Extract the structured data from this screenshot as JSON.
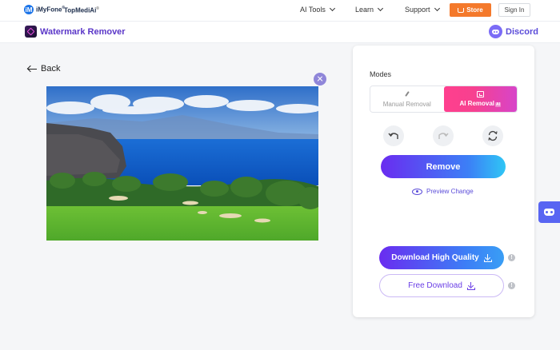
{
  "header": {
    "brand_mark": "iM",
    "brand": "iMyFone",
    "brand_sup": "®",
    "product_brand": "TopMediAi",
    "product_sup": "®",
    "nav": [
      {
        "label": "AI Tools"
      },
      {
        "label": "Learn"
      },
      {
        "label": "Support"
      }
    ],
    "store_label": "Store",
    "signin_label": "Sign In"
  },
  "toolbar": {
    "app_title": "Watermark Remover",
    "discord_label": "Discord"
  },
  "main": {
    "back_label": "Back"
  },
  "panel": {
    "modes_label": "Modes",
    "modes": [
      {
        "label": "Manual Removal",
        "active": false
      },
      {
        "label": "AI Removal",
        "badge": "AI",
        "active": true
      }
    ],
    "tools": [
      "undo-icon",
      "redo-icon",
      "reset-icon"
    ],
    "remove_label": "Remove",
    "preview_label": "Preview Change",
    "download_hq_label": "Download High Quality",
    "download_free_label": "Free Download",
    "info_symbol": "!"
  },
  "colors": {
    "accent_purple": "#6a2cf0",
    "accent_blue": "#3c7ff6",
    "ai_mode_pink": "#ff3f8e",
    "store_orange": "#f4792b",
    "discord_blue": "#5865f2"
  }
}
